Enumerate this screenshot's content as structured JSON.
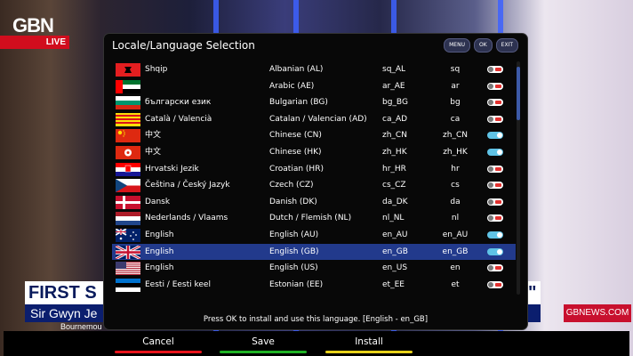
{
  "broadcast": {
    "logo": "GBN",
    "live": "LIVE",
    "headline": "FIRST S",
    "headline_end": "\"",
    "subline": "Sir Gwyn Je",
    "ticker": "Bournemou",
    "site": "GBNEWS.COM"
  },
  "dialog": {
    "title": "Locale/Language Selection",
    "buttons": {
      "menu": "MENU",
      "ok": "OK",
      "exit": "EXIT"
    },
    "hint": "Press OK to install and use this language.  [English - en_GB]"
  },
  "languages": [
    {
      "native": "Shqip",
      "name": "Albanian (AL)",
      "code": "sq_AL",
      "short": "sq",
      "installed": false,
      "flag": "al"
    },
    {
      "native": "",
      "name": "Arabic (AE)",
      "code": "ar_AE",
      "short": "ar",
      "installed": false,
      "flag": "ae"
    },
    {
      "native": "български език",
      "name": "Bulgarian (BG)",
      "code": "bg_BG",
      "short": "bg",
      "installed": false,
      "flag": "bg"
    },
    {
      "native": "Català / Valencià",
      "name": "Catalan / Valencian (AD)",
      "code": "ca_AD",
      "short": "ca",
      "installed": false,
      "flag": "ad"
    },
    {
      "native": "中文",
      "name": "Chinese (CN)",
      "code": "zh_CN",
      "short": "zh_CN",
      "installed": true,
      "flag": "cn"
    },
    {
      "native": "中文",
      "name": "Chinese (HK)",
      "code": "zh_HK",
      "short": "zh_HK",
      "installed": true,
      "flag": "hk"
    },
    {
      "native": "Hrvatski Jezik",
      "name": "Croatian (HR)",
      "code": "hr_HR",
      "short": "hr",
      "installed": false,
      "flag": "hr"
    },
    {
      "native": "Čeština / Český Jazyk",
      "name": "Czech (CZ)",
      "code": "cs_CZ",
      "short": "cs",
      "installed": false,
      "flag": "cz"
    },
    {
      "native": "Dansk",
      "name": "Danish (DK)",
      "code": "da_DK",
      "short": "da",
      "installed": false,
      "flag": "dk"
    },
    {
      "native": "Nederlands / Vlaams",
      "name": "Dutch / Flemish (NL)",
      "code": "nl_NL",
      "short": "nl",
      "installed": false,
      "flag": "nl"
    },
    {
      "native": "English",
      "name": "English (AU)",
      "code": "en_AU",
      "short": "en_AU",
      "installed": true,
      "flag": "au"
    },
    {
      "native": "English",
      "name": "English (GB)",
      "code": "en_GB",
      "short": "en_GB",
      "installed": true,
      "flag": "gb",
      "selected": true
    },
    {
      "native": "English",
      "name": "English (US)",
      "code": "en_US",
      "short": "en",
      "installed": false,
      "flag": "us"
    },
    {
      "native": "Eesti / Eesti keel",
      "name": "Estonian (EE)",
      "code": "et_EE",
      "short": "et",
      "installed": false,
      "flag": "ee"
    }
  ],
  "bottom_buttons": [
    {
      "label": "Cancel",
      "color": "#e8141c"
    },
    {
      "label": "Save",
      "color": "#1fb325"
    },
    {
      "label": "Install",
      "color": "#e8d21a"
    }
  ]
}
